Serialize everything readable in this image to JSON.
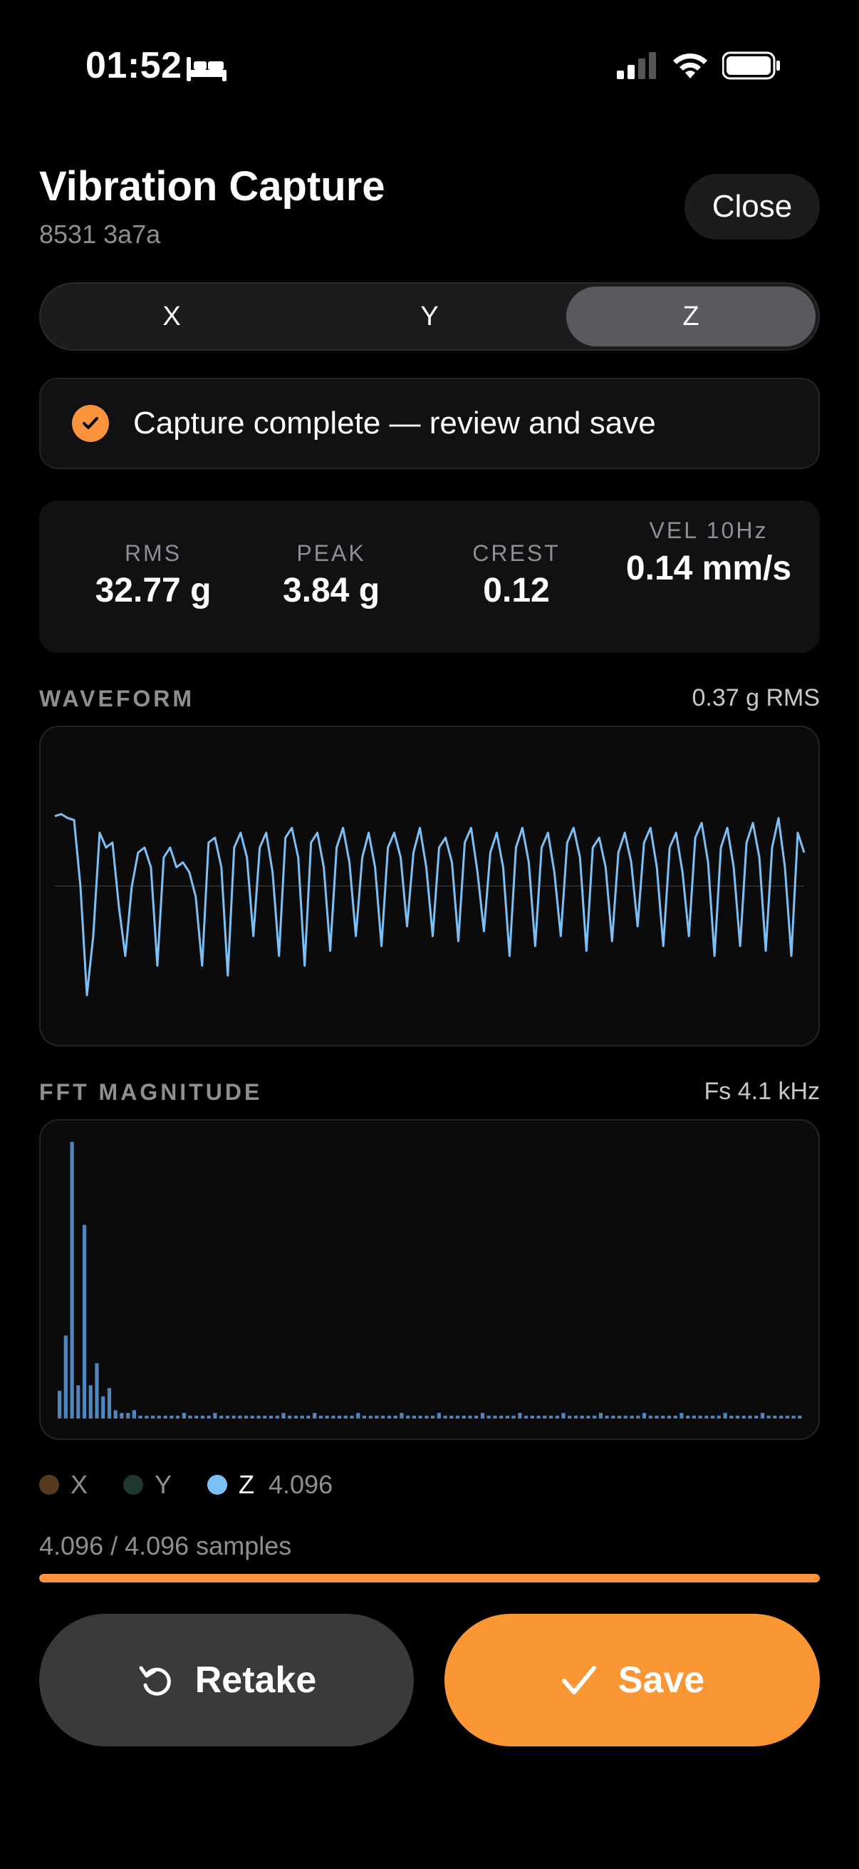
{
  "status_bar": {
    "time": "01:52"
  },
  "header": {
    "title": "Vibration Capture",
    "subtitle": "8531 3a7a",
    "close_label": "Close"
  },
  "axes": {
    "tabs": [
      "X",
      "Y",
      "Z"
    ],
    "selected": "Z"
  },
  "status": {
    "message": "Capture complete — review and save"
  },
  "metrics": [
    {
      "label": "RMS",
      "value": "32.77 g"
    },
    {
      "label": "PEAK",
      "value": "3.84 g"
    },
    {
      "label": "CREST",
      "value": "0.12"
    },
    {
      "label": "VEL 10Hz",
      "value": "0.14 mm/s"
    }
  ],
  "waveform": {
    "label": "WAVEFORM",
    "right": "0.37 g RMS"
  },
  "fft": {
    "label": "FFT MAGNITUDE",
    "right": "Fs 4.1 kHz"
  },
  "legend": {
    "items": [
      {
        "name": "X",
        "color": "#5a3a1c"
      },
      {
        "name": "Y",
        "color": "#1e3a2e"
      },
      {
        "name": "Z",
        "color": "#7cc0f5"
      }
    ],
    "z_count": "4.096"
  },
  "progress": {
    "text": "4.096 / 4.096 samples",
    "fraction": 1.0
  },
  "actions": {
    "retake_label": "Retake",
    "save_label": "Save"
  },
  "colors": {
    "accent": "#fb9634",
    "wave": "#7cc0f5",
    "fft_bar": "#4f86c0"
  },
  "chart_data": [
    {
      "type": "line",
      "title": "WAVEFORM",
      "series": [
        {
          "values": [
            0.62,
            0.64,
            0.6,
            0.58,
            -0.1,
            -1.2,
            -0.6,
            0.45,
            0.3,
            0.35,
            -0.3,
            -0.8,
            -0.1,
            0.25,
            0.3,
            0.1,
            -0.9,
            0.2,
            0.3,
            0.1,
            0.15,
            0.05,
            -0.2,
            -0.9,
            0.35,
            0.4,
            0.1,
            -1.0,
            0.3,
            0.45,
            0.2,
            -0.6,
            0.3,
            0.45,
            0.05,
            -0.8,
            0.4,
            0.5,
            0.2,
            -0.9,
            0.35,
            0.45,
            0.1,
            -0.75,
            0.3,
            0.5,
            0.15,
            -0.6,
            0.2,
            0.45,
            0.1,
            -0.7,
            0.3,
            0.45,
            0.2,
            -0.5,
            0.25,
            0.5,
            0.1,
            -0.6,
            0.3,
            0.4,
            0.15,
            -0.65,
            0.35,
            0.5,
            0.05,
            -0.55,
            0.25,
            0.45,
            0.1,
            -0.8,
            0.3,
            0.5,
            0.15,
            -0.7,
            0.3,
            0.45,
            0.05,
            -0.6,
            0.35,
            0.5,
            0.2,
            -0.75,
            0.3,
            0.4,
            0.1,
            -0.65,
            0.25,
            0.45,
            0.15,
            -0.5,
            0.35,
            0.5,
            0.1,
            -0.7,
            0.3,
            0.45,
            0.05,
            -0.6,
            0.4,
            0.55,
            0.15,
            -0.8,
            0.3,
            0.5,
            0.1,
            -0.7,
            0.35,
            0.55,
            0.2,
            -0.75,
            0.3,
            0.6,
            0.1,
            -0.8,
            0.45,
            0.25
          ]
        }
      ],
      "ylim": [
        -1.3,
        0.8
      ]
    },
    {
      "type": "bar",
      "title": "FFT MAGNITUDE",
      "values": [
        0.1,
        0.3,
        1.0,
        0.12,
        0.7,
        0.12,
        0.2,
        0.08,
        0.11,
        0.03,
        0.02,
        0.02,
        0.03,
        0.01,
        0.01,
        0.01,
        0.01,
        0.01,
        0.01,
        0.01,
        0.02,
        0.01,
        0.01,
        0.01,
        0.01,
        0.02,
        0.01,
        0.01,
        0.01,
        0.01,
        0.01,
        0.01,
        0.01,
        0.01,
        0.01,
        0.01,
        0.02,
        0.01,
        0.01,
        0.01,
        0.01,
        0.02,
        0.01,
        0.01,
        0.01,
        0.01,
        0.01,
        0.01,
        0.02,
        0.01,
        0.01,
        0.01,
        0.01,
        0.01,
        0.01,
        0.02,
        0.01,
        0.01,
        0.01,
        0.01,
        0.01,
        0.02,
        0.01,
        0.01,
        0.01,
        0.01,
        0.01,
        0.01,
        0.02,
        0.01,
        0.01,
        0.01,
        0.01,
        0.01,
        0.02,
        0.01,
        0.01,
        0.01,
        0.01,
        0.01,
        0.01,
        0.02,
        0.01,
        0.01,
        0.01,
        0.01,
        0.01,
        0.02,
        0.01,
        0.01,
        0.01,
        0.01,
        0.01,
        0.01,
        0.02,
        0.01,
        0.01,
        0.01,
        0.01,
        0.01,
        0.02,
        0.01,
        0.01,
        0.01,
        0.01,
        0.01,
        0.01,
        0.02,
        0.01,
        0.01,
        0.01,
        0.01,
        0.01,
        0.02,
        0.01,
        0.01,
        0.01,
        0.01,
        0.01,
        0.01
      ],
      "ylim": [
        0,
        1
      ]
    }
  ]
}
